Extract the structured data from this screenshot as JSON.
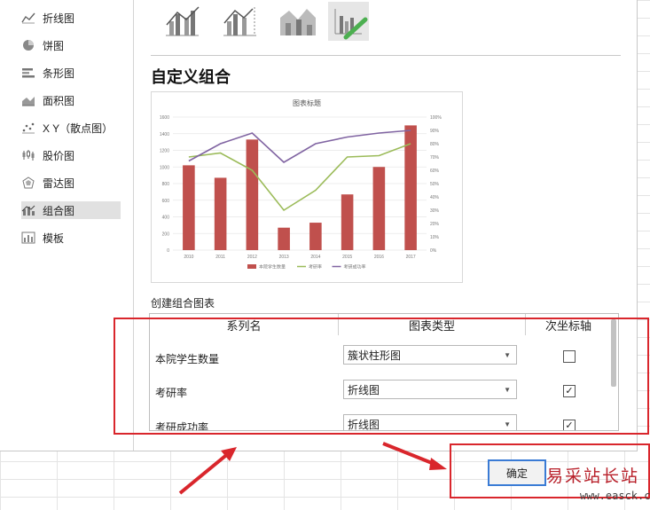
{
  "sidebar": {
    "items": [
      {
        "label": "折线图",
        "icon": "line-chart-icon"
      },
      {
        "label": "饼图",
        "icon": "pie-chart-icon"
      },
      {
        "label": "条形图",
        "icon": "bar-chart-icon"
      },
      {
        "label": "面积图",
        "icon": "area-chart-icon"
      },
      {
        "label": "X Y（散点图）",
        "icon": "scatter-chart-icon"
      },
      {
        "label": "股价图",
        "icon": "stock-chart-icon"
      },
      {
        "label": "雷达图",
        "icon": "radar-chart-icon"
      },
      {
        "label": "组合图",
        "icon": "combo-chart-icon",
        "selected": true
      },
      {
        "label": "模板",
        "icon": "template-icon"
      }
    ]
  },
  "combo": {
    "title": "自定义组合",
    "create_label": "创建组合图表",
    "selected_subtype_index": 3
  },
  "preview": {
    "chart_data": {
      "type": "bar",
      "title": "图表标题",
      "categories": [
        "2010",
        "2011",
        "2012",
        "2013",
        "2014",
        "2015",
        "2016",
        "2017"
      ],
      "series": [
        {
          "name": "本院学生数量",
          "type": "bar",
          "axis": "primary",
          "color": "#c0504d",
          "values": [
            1020,
            870,
            1330,
            270,
            330,
            670,
            1000,
            1500
          ]
        },
        {
          "name": "考研率",
          "type": "line",
          "axis": "secondary",
          "color": "#9bbb59",
          "values": [
            70,
            73,
            60,
            30,
            45,
            70,
            71,
            80
          ]
        },
        {
          "name": "考研成功率",
          "type": "line",
          "axis": "secondary",
          "color": "#8064a2",
          "values": [
            67,
            80,
            88,
            66,
            80,
            85,
            88,
            90
          ]
        }
      ],
      "y_ticks": [
        "0",
        "200",
        "400",
        "600",
        "800",
        "1000",
        "1200",
        "1400",
        "1600"
      ],
      "y2_ticks": [
        "0%",
        "10%",
        "20%",
        "30%",
        "40%",
        "50%",
        "60%",
        "70%",
        "80%",
        "90%",
        "100%"
      ],
      "ylim": [
        0,
        1600
      ],
      "y2lim": [
        0,
        100
      ],
      "grid": true,
      "legend": "bottom"
    }
  },
  "table": {
    "headers": {
      "name": "系列名",
      "type": "图表类型",
      "secondary": "次坐标轴"
    },
    "rows": [
      {
        "name": "本院学生数量",
        "type": "簇状柱形图",
        "secondary": false
      },
      {
        "name": "考研率",
        "type": "折线图",
        "secondary": true
      },
      {
        "name": "考研成功率",
        "type": "折线图",
        "secondary": true
      }
    ]
  },
  "footer": {
    "ok_label": "确定"
  },
  "watermark": {
    "text": "易采站长站",
    "url": "www.easck.com"
  },
  "colors": {
    "highlight": "#d9262c",
    "accent": "#3a7bd5",
    "bar": "#c0504d",
    "line1": "#9bbb59",
    "line2": "#8064a2"
  }
}
